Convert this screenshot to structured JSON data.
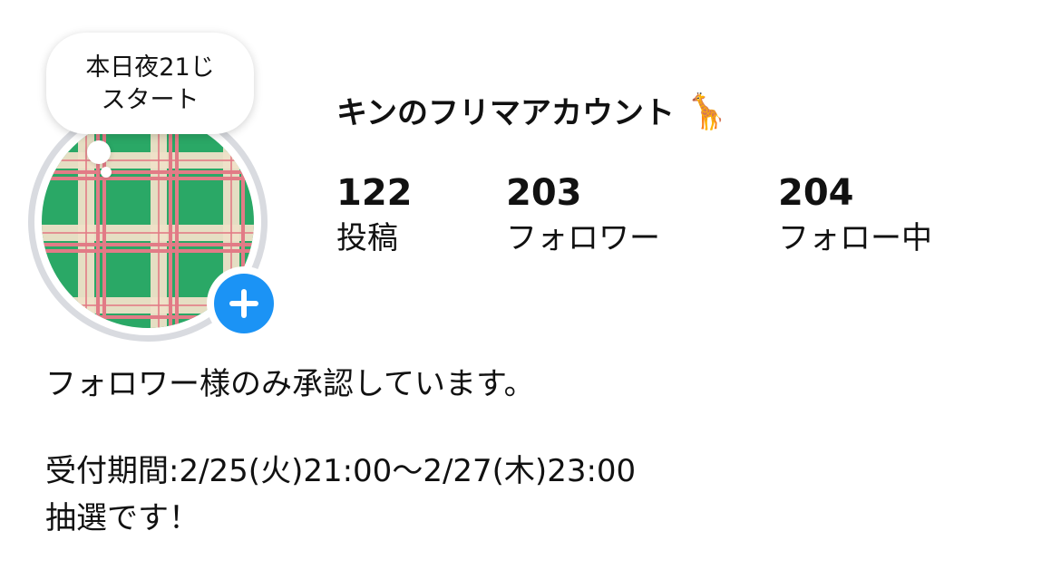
{
  "note": {
    "line1": "本日夜21じ",
    "line2": "スタート"
  },
  "profile": {
    "name": "キンのフリマアカウント",
    "name_emoji": "🦒",
    "avatar_icon": "green-plaid-pattern-avatar",
    "add_story_icon": "plus-icon"
  },
  "stats": {
    "posts": {
      "value": "122",
      "label": "投稿"
    },
    "followers": {
      "value": "203",
      "label": "フォロワー"
    },
    "following": {
      "value": "204",
      "label": "フォロー中"
    }
  },
  "bio": {
    "line1": "フォロワー様のみ承認しています。",
    "line2": "受付期間:2/25(火)21:00～2/27(木)23:00",
    "line3": "抽選です！"
  },
  "colors": {
    "accent": "#1b93f5",
    "avatar_ring": "#d9dbe0",
    "plaid_green": "#2aa866",
    "plaid_cream": "#efe0c8",
    "plaid_pink": "#e27b86"
  }
}
